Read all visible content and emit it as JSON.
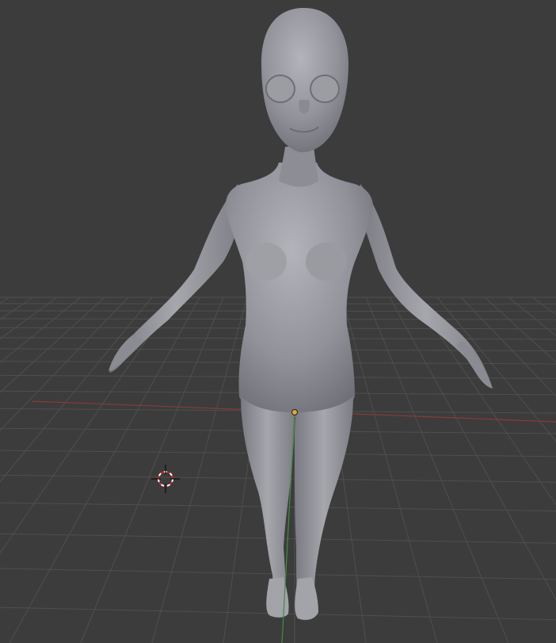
{
  "viewport": {
    "mode": "3D Viewport",
    "shading": "solid",
    "background_color": "#3c3c3c",
    "grid_color": "#4f4f4f",
    "x_axis_color": "#8a3a3a",
    "y_axis_color": "#3e8e3e",
    "mesh_color": "#8e8e95"
  },
  "scene": {
    "objects": [
      {
        "name_shown": "",
        "kind": "humanoid-mesh",
        "selected_origin": true
      }
    ],
    "cursor_3d": {
      "icon": "3d-cursor-icon"
    },
    "origin": {
      "icon": "origin-dot-icon",
      "color": "#e8a040"
    }
  }
}
